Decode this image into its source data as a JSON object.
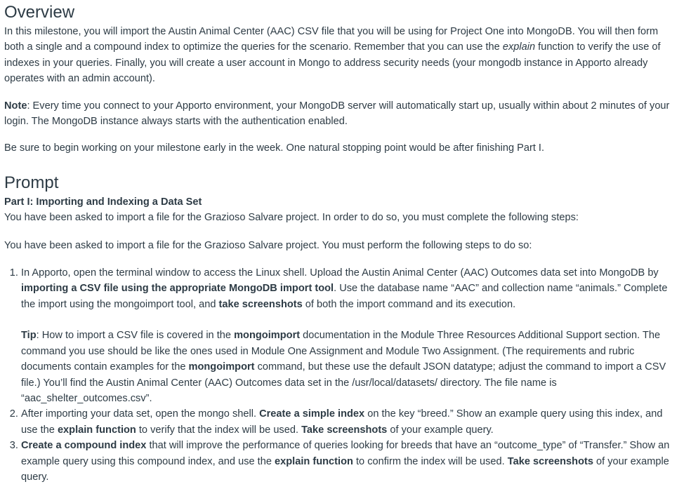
{
  "overview": {
    "title": "Overview",
    "p1": [
      {
        "t": "In this milestone, you will import the Austin Animal Center (AAC) CSV file that you will be using for Project One into MongoDB. You will then form both a single and a compound index to optimize the queries for the scenario. Remember that you can use the ",
        "s": ""
      },
      {
        "t": "explain",
        "s": "i"
      },
      {
        "t": " function to verify the use of indexes in your queries. Finally, you will create a user account in Mongo to address security needs (your mongodb instance in Apporto already operates with an admin account).",
        "s": ""
      }
    ],
    "note": [
      {
        "t": "Note",
        "s": "b"
      },
      {
        "t": ": Every time you connect to your Apporto environment, your MongoDB server will automatically start up, usually within about 2 minutes of your login. The MongoDB instance always starts with the authentication enabled.",
        "s": ""
      }
    ],
    "begin": "Be sure to begin working on your milestone early in the week. One natural stopping point would be after finishing Part I."
  },
  "prompt": {
    "title": "Prompt",
    "part1_heading": "Part I: Importing and Indexing a Data Set",
    "intro1": "You have been asked to import a file for the Grazioso Salvare project. In order to do so, you must complete the following steps:",
    "intro2": "You have been asked to import a file for the Grazioso Salvare project. You must perform the following steps to do so:",
    "steps": [
      {
        "text": [
          {
            "t": "In Apporto, open the terminal window to access the Linux shell. Upload the Austin Animal Center (AAC) Outcomes data set into MongoDB by ",
            "s": ""
          },
          {
            "t": "importing a CSV file using the appropriate MongoDB import tool",
            "s": "b"
          },
          {
            "t": ". Use the database name “AAC” and collection name “animals.” Complete the import using the mongoimport tool, and ",
            "s": ""
          },
          {
            "t": "take screenshots",
            "s": "b"
          },
          {
            "t": " of both the import command and its execution.",
            "s": ""
          }
        ],
        "tip": [
          {
            "t": "Tip",
            "s": "b"
          },
          {
            "t": ": How to import a CSV file is covered in the ",
            "s": ""
          },
          {
            "t": "mongoimport",
            "s": "b"
          },
          {
            "t": " documentation in the Module Three Resources Additional Support section. The command you use should be like the ones used in Module One Assignment and Module Two Assignment. (The requirements and rubric documents contain examples for the ",
            "s": ""
          },
          {
            "t": "mongoimport",
            "s": "b"
          },
          {
            "t": " command, but these use the default JSON datatype; adjust the command to import a CSV file.) You’ll find the Austin Animal Center (AAC) Outcomes data set in the /usr/local/datasets/ directory. The file name is “aac_shelter_outcomes.csv”.",
            "s": ""
          }
        ]
      },
      {
        "text": [
          {
            "t": "After importing your data set, open the mongo shell. ",
            "s": ""
          },
          {
            "t": "Create a simple index",
            "s": "b"
          },
          {
            "t": " on the key “breed.” Show an example query using this index, and use the ",
            "s": ""
          },
          {
            "t": "explain function",
            "s": "b"
          },
          {
            "t": " to verify that the index will be used. ",
            "s": ""
          },
          {
            "t": "Take screenshots",
            "s": "b"
          },
          {
            "t": " of your example query.",
            "s": ""
          }
        ]
      },
      {
        "text": [
          {
            "t": "Create a compound index",
            "s": "b"
          },
          {
            "t": " that will improve the performance of queries looking for breeds that have an “outcome_type” of “Transfer.” Show an example query using this compound index, and use the ",
            "s": ""
          },
          {
            "t": "explain function",
            "s": "b"
          },
          {
            "t": " to confirm the index will be used. ",
            "s": ""
          },
          {
            "t": "Take screenshots",
            "s": "b"
          },
          {
            "t": " of your example query.",
            "s": ""
          }
        ]
      }
    ]
  }
}
